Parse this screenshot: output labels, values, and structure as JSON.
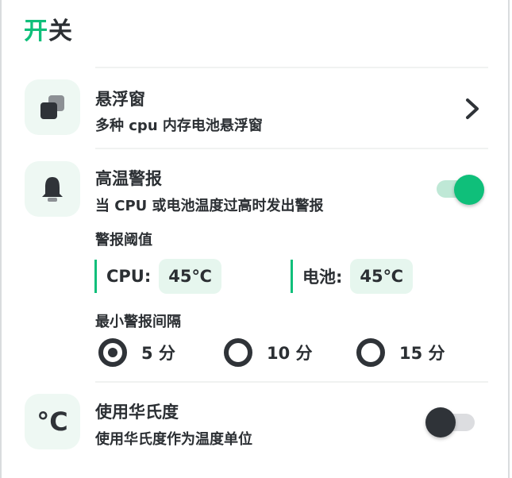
{
  "header": {
    "title_accent": "开",
    "title_rest": "关"
  },
  "floating_window": {
    "title": "悬浮窗",
    "subtitle": "多种 cpu 内存电池悬浮窗",
    "icon": "floating-window-icon"
  },
  "high_temp_alert": {
    "title": "高温警报",
    "subtitle": "当 CPU 或电池温度过高时发出警报",
    "enabled": true,
    "icon": "bell-icon",
    "threshold_label": "警报阈值",
    "cpu_label": "CPU:",
    "cpu_value": "45℃",
    "battery_label": "电池:",
    "battery_value": "45℃",
    "interval_label": "最小警报间隔",
    "intervals": [
      {
        "label": "5 分",
        "selected": true
      },
      {
        "label": "10 分",
        "selected": false
      },
      {
        "label": "15 分",
        "selected": false
      }
    ]
  },
  "fahrenheit": {
    "title": "使用华氏度",
    "subtitle": "使用华氏度作为温度单位",
    "enabled": false,
    "icon": "celsius-icon",
    "icon_text": "°C"
  },
  "colors": {
    "accent": "#0fbf7a",
    "accent_light": "#bfe8d6",
    "tile_bg": "#eef8f3",
    "text": "#2b2f33"
  }
}
